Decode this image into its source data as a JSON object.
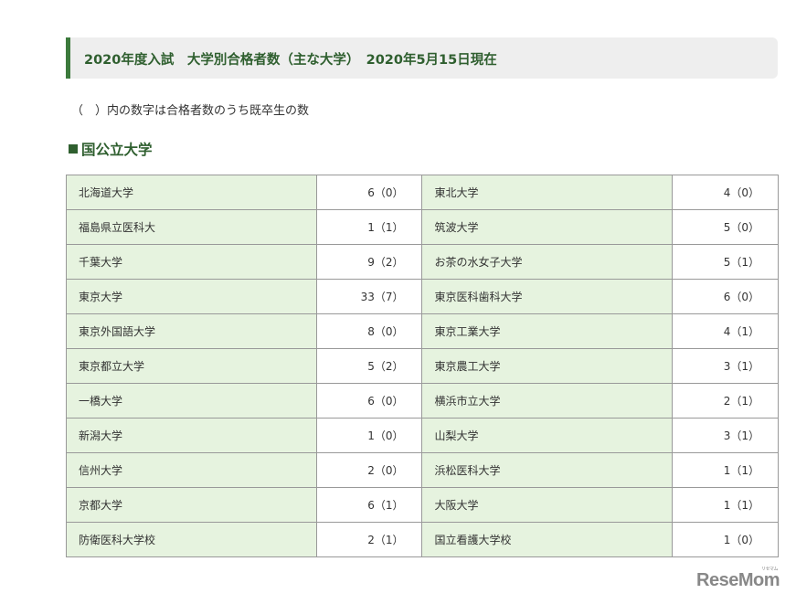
{
  "heading": "2020年度入試　大学別合格者数（主な大学）　2020年5月15日現在",
  "note": "（　）内の数字は合格者数のうち既卒生の数",
  "section_title": "国公立大学",
  "rows": [
    {
      "left_name": "北海道大学",
      "left_value": "6（0）",
      "right_name": "東北大学",
      "right_value": "4（0）"
    },
    {
      "left_name": "福島県立医科大",
      "left_value": "1（1）",
      "right_name": "筑波大学",
      "right_value": "5（0）"
    },
    {
      "left_name": "千葉大学",
      "left_value": "9（2）",
      "right_name": "お茶の水女子大学",
      "right_value": "5（1）"
    },
    {
      "left_name": "東京大学",
      "left_value": "33（7）",
      "right_name": "東京医科歯科大学",
      "right_value": "6（0）"
    },
    {
      "left_name": "東京外国語大学",
      "left_value": "8（0）",
      "right_name": "東京工業大学",
      "right_value": "4（1）"
    },
    {
      "left_name": "東京都立大学",
      "left_value": "5（2）",
      "right_name": "東京農工大学",
      "right_value": "3（1）"
    },
    {
      "left_name": "一橋大学",
      "left_value": "6（0）",
      "right_name": "横浜市立大学",
      "right_value": "2（1）"
    },
    {
      "left_name": "新潟大学",
      "left_value": "1（0）",
      "right_name": "山梨大学",
      "right_value": "3（1）"
    },
    {
      "left_name": "信州大学",
      "left_value": "2（0）",
      "right_name": "浜松医科大学",
      "right_value": "1（1）"
    },
    {
      "left_name": "京都大学",
      "left_value": "6（1）",
      "right_name": "大阪大学",
      "right_value": "1（1）"
    },
    {
      "left_name": "防衛医科大学校",
      "left_value": "2（1）",
      "right_name": "国立看護大学校",
      "right_value": "1（0）"
    }
  ],
  "logo": "ReseMom",
  "logo_kana": "リセマム"
}
